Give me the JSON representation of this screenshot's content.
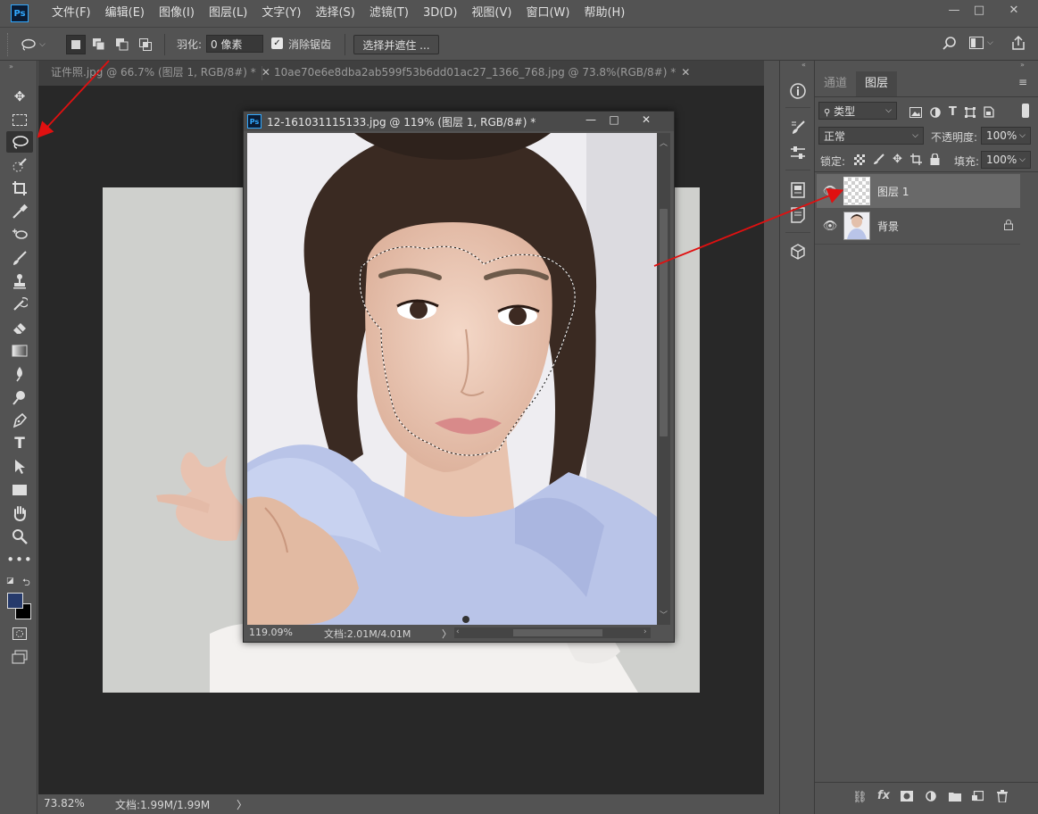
{
  "app": {
    "logo": "Ps",
    "menu": [
      "文件(F)",
      "编辑(E)",
      "图像(I)",
      "图层(L)",
      "文字(Y)",
      "选择(S)",
      "滤镜(T)",
      "3D(D)",
      "视图(V)",
      "窗口(W)",
      "帮助(H)"
    ],
    "window_controls": {
      "minimize": "—",
      "maximize": "□",
      "close": "✕"
    }
  },
  "options": {
    "feather_label": "羽化:",
    "feather_value": "0 像素",
    "antialias_label": "消除锯齿",
    "antialias_checked": true,
    "select_mask_button": "选择并遮住 ..."
  },
  "tabs": [
    {
      "label": "证件照.jpg @ 66.7% (图层 1, RGB/8#) *",
      "close": "✕"
    },
    {
      "label": "10ae70e6e8dba2ab599f53b6dd01ac27_1366_768.jpg @ 73.8%(RGB/8#) *",
      "close": "✕"
    }
  ],
  "main_status": {
    "zoom": "73.82%",
    "doc": "文档:1.99M/1.99M",
    "arrow": "〉"
  },
  "float_window": {
    "title": "12-161031115133.jpg @ 119% (图层 1, RGB/8#) *",
    "zoom": "119.09%",
    "doc": "文档:2.01M/4.01M",
    "arrow": "〉"
  },
  "panel": {
    "tabs": [
      "通道",
      "图层"
    ],
    "active_tab": "图层",
    "filter_kind": "类型",
    "blend_mode": "正常",
    "opacity_label": "不透明度:",
    "opacity_value": "100%",
    "lock_label": "锁定:",
    "fill_label": "填充:",
    "fill_value": "100%",
    "layers": [
      {
        "name": "图层 1",
        "selected": true,
        "locked": false
      },
      {
        "name": "背景",
        "selected": false,
        "locked": true
      }
    ],
    "bottom_icons": [
      "link-icon",
      "fx-icon",
      "mask-icon",
      "adjustment-icon",
      "folder-icon",
      "new-layer-icon",
      "trash-icon"
    ],
    "fx_label": "fx"
  },
  "colors": {
    "accent": "#31a8ff",
    "annotation_arrow": "#e01010",
    "foreground_swatch": "#263a6b",
    "background_swatch": "#000000"
  }
}
